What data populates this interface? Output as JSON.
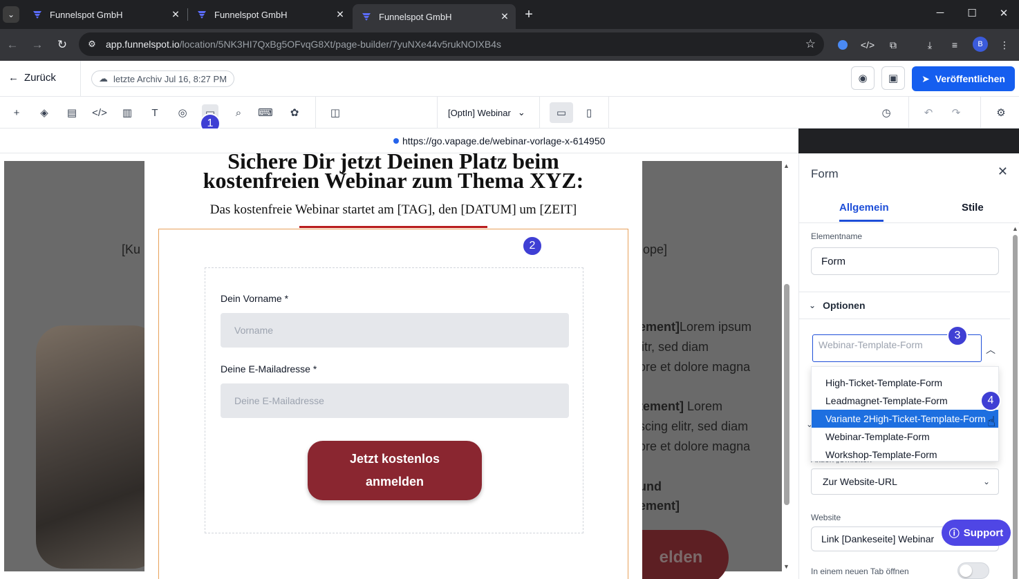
{
  "browser": {
    "tabs": [
      {
        "title": "Funnelspot GmbH",
        "active": false
      },
      {
        "title": "Funnelspot GmbH",
        "active": false
      },
      {
        "title": "Funnelspot GmbH",
        "active": true
      }
    ],
    "url_host": "app.funnelspot.io",
    "url_path": "/location/5NK3HI7QxBg5OFvqG8Xt/page-builder/7yuNXe44v5rukNOIXB4s",
    "profile_initial": "B"
  },
  "header": {
    "back_label": "Zurück",
    "archive_label": "letzte Archiv Jul 16, 8:27 PM",
    "publish_label": "Veröffentlichen"
  },
  "toolbar": {
    "page_select": "[OptIn] Webinar"
  },
  "preview_url": "https://go.vapage.de/webinar-vorlage-x-614950",
  "canvas": {
    "headline_line1": "Sichere Dir jetzt Deinen Platz beim",
    "headline_line2": "kostenfreien Webinar zum Thema XYZ:",
    "subline": "Das kostenfreie Webinar startet am [TAG], den [DATUM] um [ZEIT]",
    "bg_left_fragment": "[Ku",
    "bg_right_fragment": "ope]",
    "bg_lines": [
      {
        "bold": "ement]",
        "text": "Lorem ipsum"
      },
      {
        "bold": "",
        "text": "litr, sed diam"
      },
      {
        "bold": "",
        "text": "ore et dolore magna"
      },
      {
        "bold": "tement]",
        "text": " Lorem"
      },
      {
        "bold": "",
        "text": "scing elitr, sed diam"
      },
      {
        "bold": "",
        "text": "ore et dolore magna"
      },
      {
        "bold": "und",
        "text": ""
      },
      {
        "bold": "ement]",
        "text": ""
      }
    ],
    "bg_button_fragment": "elden",
    "form": {
      "firstname_label": "Dein Vorname *",
      "firstname_placeholder": "Vorname",
      "email_label": "Deine E-Mailadresse *",
      "email_placeholder": "Deine E-Mailadresse",
      "cta_line1": "Jetzt kostenlos",
      "cta_line2": "anmelden"
    }
  },
  "markers": [
    "1",
    "2",
    "3",
    "4"
  ],
  "panel": {
    "title": "Form",
    "tab_general": "Allgemein",
    "tab_styles": "Stile",
    "element_name_label": "Elementname",
    "element_name_value": "Form",
    "section_options": "Optionen",
    "combo_value": "Webinar-Template-Form",
    "dropdown_options": [
      "High-Ticket-Template-Form",
      "Leadmagnet-Template-Form",
      "Variante 2High-Ticket-Template-Form",
      "Webinar-Template-Form",
      "Workshop-Template-Form"
    ],
    "selected_option": "Variante 2High-Ticket-Template-Form",
    "action_label": "Aktion „Umleiten\"",
    "action_value": "Zur Website-URL",
    "website_label": "Website",
    "website_value": "Link [Dankeseite] Webinar",
    "new_tab_label": "In einem neuen Tab öffnen",
    "support_label": "Support"
  },
  "colors": {
    "accent": "#155eef",
    "cta": "#8a2630",
    "marker": "#3f3fd4",
    "selected_option": "#1d6fe0"
  }
}
